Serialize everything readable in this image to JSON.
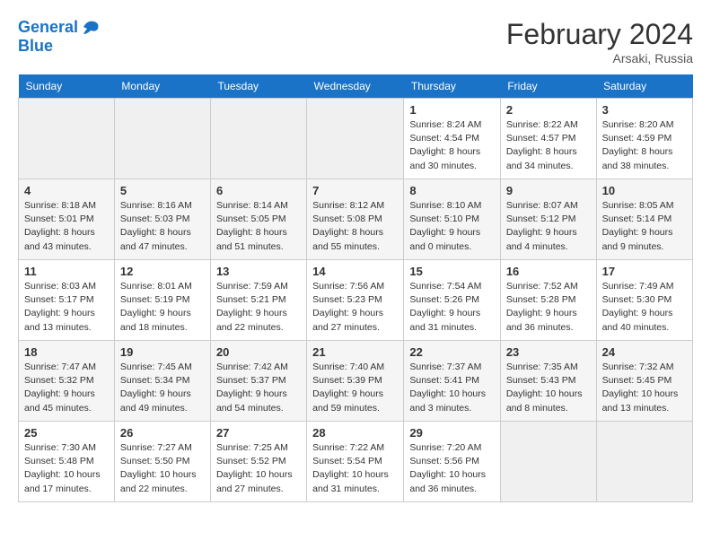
{
  "header": {
    "logo_line1": "General",
    "logo_line2": "Blue",
    "month": "February 2024",
    "location": "Arsaki, Russia"
  },
  "weekdays": [
    "Sunday",
    "Monday",
    "Tuesday",
    "Wednesday",
    "Thursday",
    "Friday",
    "Saturday"
  ],
  "weeks": [
    [
      {
        "day": "",
        "empty": true
      },
      {
        "day": "",
        "empty": true
      },
      {
        "day": "",
        "empty": true
      },
      {
        "day": "",
        "empty": true
      },
      {
        "day": "1",
        "sunrise": "8:24 AM",
        "sunset": "4:54 PM",
        "daylight": "8 hours and 30 minutes."
      },
      {
        "day": "2",
        "sunrise": "8:22 AM",
        "sunset": "4:57 PM",
        "daylight": "8 hours and 34 minutes."
      },
      {
        "day": "3",
        "sunrise": "8:20 AM",
        "sunset": "4:59 PM",
        "daylight": "8 hours and 38 minutes."
      }
    ],
    [
      {
        "day": "4",
        "sunrise": "8:18 AM",
        "sunset": "5:01 PM",
        "daylight": "8 hours and 43 minutes."
      },
      {
        "day": "5",
        "sunrise": "8:16 AM",
        "sunset": "5:03 PM",
        "daylight": "8 hours and 47 minutes."
      },
      {
        "day": "6",
        "sunrise": "8:14 AM",
        "sunset": "5:05 PM",
        "daylight": "8 hours and 51 minutes."
      },
      {
        "day": "7",
        "sunrise": "8:12 AM",
        "sunset": "5:08 PM",
        "daylight": "8 hours and 55 minutes."
      },
      {
        "day": "8",
        "sunrise": "8:10 AM",
        "sunset": "5:10 PM",
        "daylight": "9 hours and 0 minutes."
      },
      {
        "day": "9",
        "sunrise": "8:07 AM",
        "sunset": "5:12 PM",
        "daylight": "9 hours and 4 minutes."
      },
      {
        "day": "10",
        "sunrise": "8:05 AM",
        "sunset": "5:14 PM",
        "daylight": "9 hours and 9 minutes."
      }
    ],
    [
      {
        "day": "11",
        "sunrise": "8:03 AM",
        "sunset": "5:17 PM",
        "daylight": "9 hours and 13 minutes."
      },
      {
        "day": "12",
        "sunrise": "8:01 AM",
        "sunset": "5:19 PM",
        "daylight": "9 hours and 18 minutes."
      },
      {
        "day": "13",
        "sunrise": "7:59 AM",
        "sunset": "5:21 PM",
        "daylight": "9 hours and 22 minutes."
      },
      {
        "day": "14",
        "sunrise": "7:56 AM",
        "sunset": "5:23 PM",
        "daylight": "9 hours and 27 minutes."
      },
      {
        "day": "15",
        "sunrise": "7:54 AM",
        "sunset": "5:26 PM",
        "daylight": "9 hours and 31 minutes."
      },
      {
        "day": "16",
        "sunrise": "7:52 AM",
        "sunset": "5:28 PM",
        "daylight": "9 hours and 36 minutes."
      },
      {
        "day": "17",
        "sunrise": "7:49 AM",
        "sunset": "5:30 PM",
        "daylight": "9 hours and 40 minutes."
      }
    ],
    [
      {
        "day": "18",
        "sunrise": "7:47 AM",
        "sunset": "5:32 PM",
        "daylight": "9 hours and 45 minutes."
      },
      {
        "day": "19",
        "sunrise": "7:45 AM",
        "sunset": "5:34 PM",
        "daylight": "9 hours and 49 minutes."
      },
      {
        "day": "20",
        "sunrise": "7:42 AM",
        "sunset": "5:37 PM",
        "daylight": "9 hours and 54 minutes."
      },
      {
        "day": "21",
        "sunrise": "7:40 AM",
        "sunset": "5:39 PM",
        "daylight": "9 hours and 59 minutes."
      },
      {
        "day": "22",
        "sunrise": "7:37 AM",
        "sunset": "5:41 PM",
        "daylight": "10 hours and 3 minutes."
      },
      {
        "day": "23",
        "sunrise": "7:35 AM",
        "sunset": "5:43 PM",
        "daylight": "10 hours and 8 minutes."
      },
      {
        "day": "24",
        "sunrise": "7:32 AM",
        "sunset": "5:45 PM",
        "daylight": "10 hours and 13 minutes."
      }
    ],
    [
      {
        "day": "25",
        "sunrise": "7:30 AM",
        "sunset": "5:48 PM",
        "daylight": "10 hours and 17 minutes."
      },
      {
        "day": "26",
        "sunrise": "7:27 AM",
        "sunset": "5:50 PM",
        "daylight": "10 hours and 22 minutes."
      },
      {
        "day": "27",
        "sunrise": "7:25 AM",
        "sunset": "5:52 PM",
        "daylight": "10 hours and 27 minutes."
      },
      {
        "day": "28",
        "sunrise": "7:22 AM",
        "sunset": "5:54 PM",
        "daylight": "10 hours and 31 minutes."
      },
      {
        "day": "29",
        "sunrise": "7:20 AM",
        "sunset": "5:56 PM",
        "daylight": "10 hours and 36 minutes."
      },
      {
        "day": "",
        "empty": true
      },
      {
        "day": "",
        "empty": true
      }
    ]
  ]
}
